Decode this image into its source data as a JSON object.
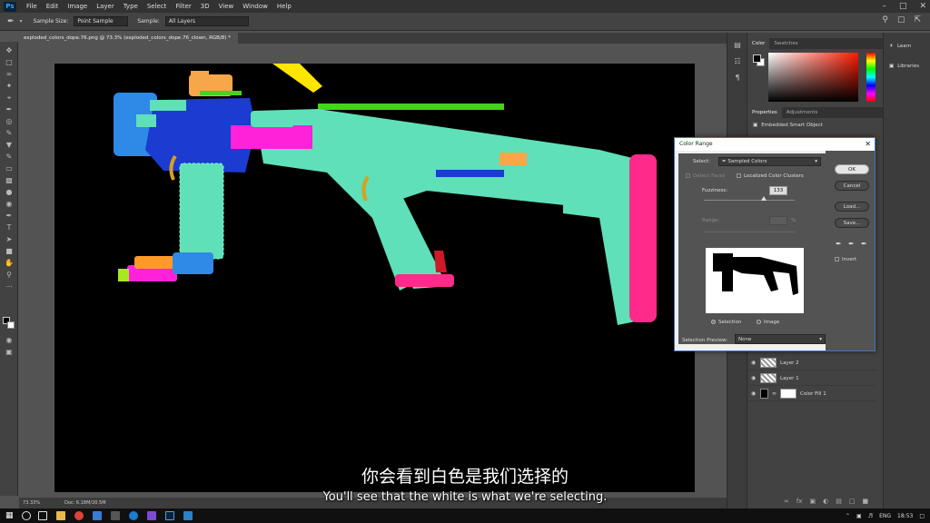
{
  "app": {
    "logo": "Ps",
    "menu": [
      "File",
      "Edit",
      "Image",
      "Layer",
      "Type",
      "Select",
      "Filter",
      "3D",
      "View",
      "Window",
      "Help"
    ]
  },
  "options_bar": {
    "sample_size_label": "Sample Size:",
    "sample_size_value": "Point Sample",
    "sample_label": "Sample:",
    "sample_value": "All Layers"
  },
  "document": {
    "tab_title": "exploded_colors_dope.76.png @ 73.3% (exploded_colors_dope.76_clown, RGB/8) *",
    "zoom": "73.33%",
    "doc_info": "Doc: 6.18M/20.5M"
  },
  "panels": {
    "color_tabs": [
      "Color",
      "Swatches"
    ],
    "properties_tabs": [
      "Properties",
      "Adjustments"
    ],
    "smart_object_label": "Embedded Smart Object",
    "layers": [
      {
        "name": "Layer 2"
      },
      {
        "name": "Layer 1"
      },
      {
        "name": "Color Fill 1"
      }
    ],
    "learn": "Learn",
    "libraries": "Libraries"
  },
  "dialog": {
    "title": "Color Range",
    "select_label": "Select:",
    "select_value": "Sampled Colors",
    "detect_faces": "Detect Faces",
    "localized_clusters": "Localized Color Clusters",
    "fuzziness_label": "Fuzziness:",
    "fuzziness_value": "133",
    "range_label": "Range:",
    "range_unit": "%",
    "fuzziness_level": 0.66,
    "radio_selection": "Selection",
    "radio_image": "Image",
    "selection_preview_label": "Selection Preview:",
    "selection_preview_value": "None",
    "buttons": {
      "ok": "OK",
      "cancel": "Cancel",
      "load": "Load...",
      "save": "Save..."
    },
    "invert": "Invert"
  },
  "subtitles": {
    "zh": "你会看到白色是我们选择的",
    "en": "You'll see that the white is what we're selecting."
  },
  "taskbar": {
    "language": "ENG",
    "time": "18:53"
  },
  "colors": {
    "accent_mint": "#5fe0b8",
    "accent_pink": "#ff2a8a",
    "accent_blue": "#1b3bd1",
    "accent_magenta": "#ff22d8",
    "accent_yellow": "#ffe600"
  }
}
